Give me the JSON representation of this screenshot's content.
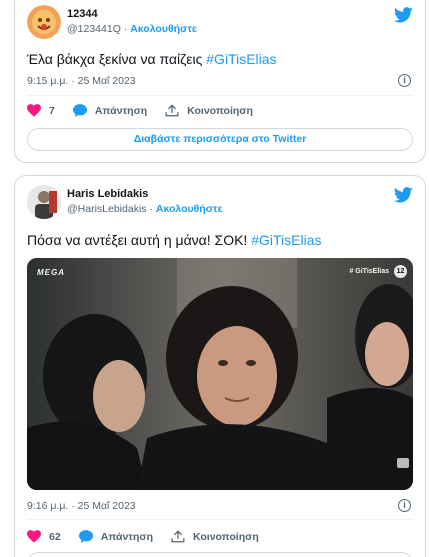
{
  "tweets": [
    {
      "name": "12344",
      "handle": "@123441Q",
      "separator": "·",
      "follow_label": "Ακολουθήστε",
      "text_main": "Έλα βάκχα ξεκίνα να παίζεις ",
      "hashtag": "#GiTisElias",
      "timestamp": "9:15 μ.μ. · 25 Μαΐ 2023",
      "likes": "7",
      "reply_label": "Απάντηση",
      "share_label": "Κοινοποίηση",
      "read_more_label": "Διαβάστε περισσότερα στο Twitter"
    },
    {
      "name": "Haris Lebidakis",
      "handle": "@HarisLebidakis",
      "separator": "·",
      "follow_label": "Ακολουθήστε",
      "text_main": "Πόσα να αντέξει αυτή η μάνα! ΣΟΚ! ",
      "hashtag": "#GiTisElias",
      "timestamp": "9:16 μ.μ. · 25 Μαΐ 2023",
      "likes": "62",
      "reply_label": "Απάντηση",
      "share_label": "Κοινοποίηση",
      "media": {
        "channel_logo": "ΜΕGΑ",
        "overlay_tag": "# GiTisElias",
        "rating": "12"
      }
    }
  ],
  "icons": {
    "brand": "twitter-bird-icon",
    "info": "info-icon",
    "like": "heart-icon",
    "reply": "reply-bubble-icon",
    "share": "share-upload-icon"
  },
  "colors": {
    "accent": "#1d9bf0",
    "like": "#f91880",
    "text": "#0f1419",
    "muted": "#536471",
    "border": "#cfd9de"
  }
}
